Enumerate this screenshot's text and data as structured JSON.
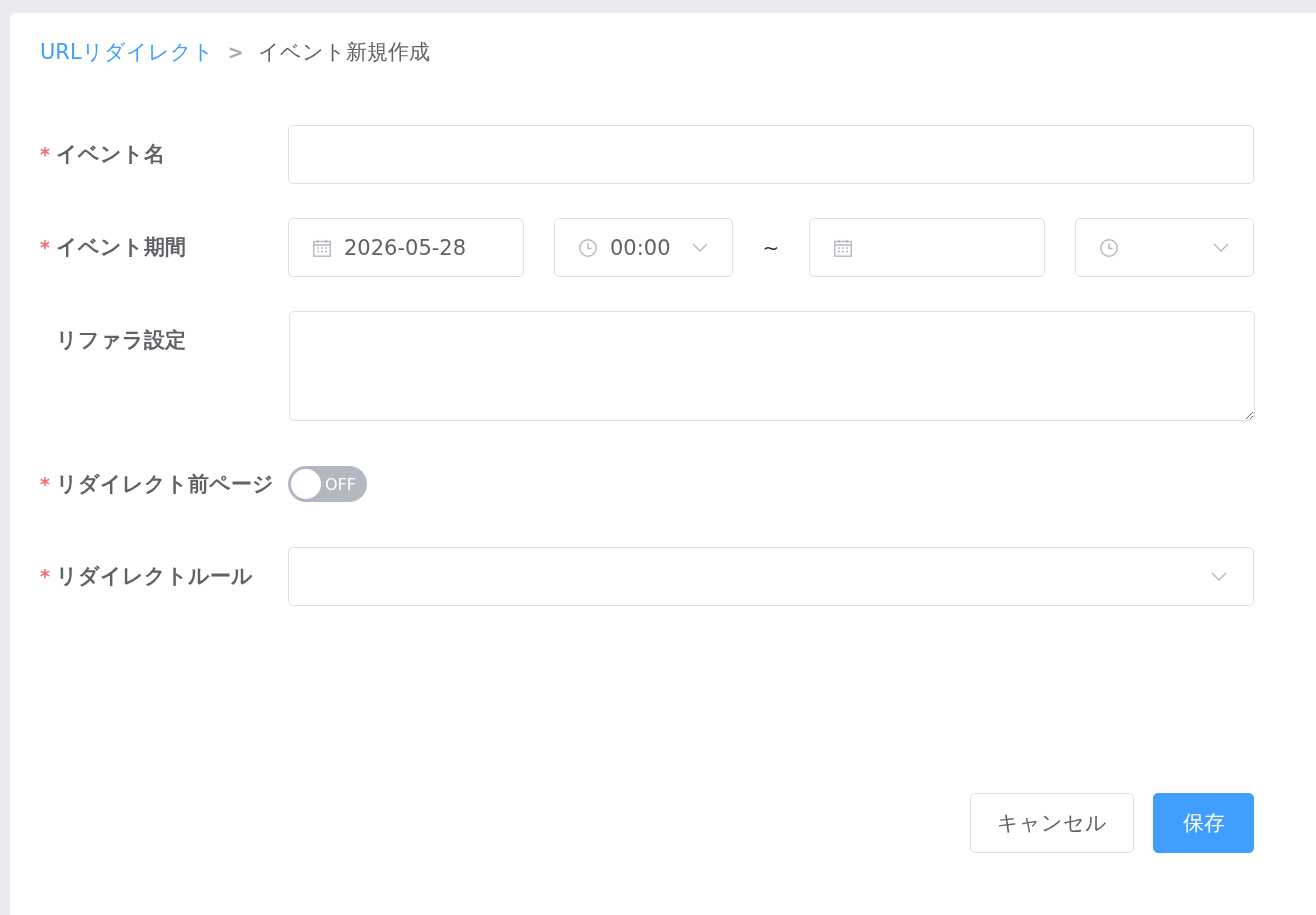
{
  "breadcrumb": [
    {
      "kind": "link",
      "label": "URLリダイレクト"
    },
    {
      "kind": "separator",
      "label": ">"
    },
    {
      "kind": "current",
      "label": "イベント新規作成"
    }
  ],
  "form": {
    "fields": [
      {
        "kind": "text",
        "required_mark": "*",
        "label": "イベント名"
      },
      {
        "kind": "period",
        "required_mark": "*",
        "label": "イベント期間",
        "parts": [
          {
            "kind": "date",
            "value": "2026-05-28"
          },
          {
            "kind": "time",
            "value": "00:00"
          },
          {
            "kind": "separator",
            "text": "~"
          },
          {
            "kind": "date"
          },
          {
            "kind": "time"
          }
        ]
      },
      {
        "kind": "textarea",
        "label": "リファラ設定"
      },
      {
        "kind": "switch",
        "required_mark": "*",
        "label": "リダイレクト前ページ",
        "on": false,
        "state_text": "OFF"
      },
      {
        "kind": "select",
        "required_mark": "*",
        "label": "リダイレクトルール"
      }
    ]
  },
  "buttons": [
    {
      "kind": "secondary",
      "label": "キャンセル"
    },
    {
      "kind": "primary",
      "label": "保存"
    }
  ]
}
